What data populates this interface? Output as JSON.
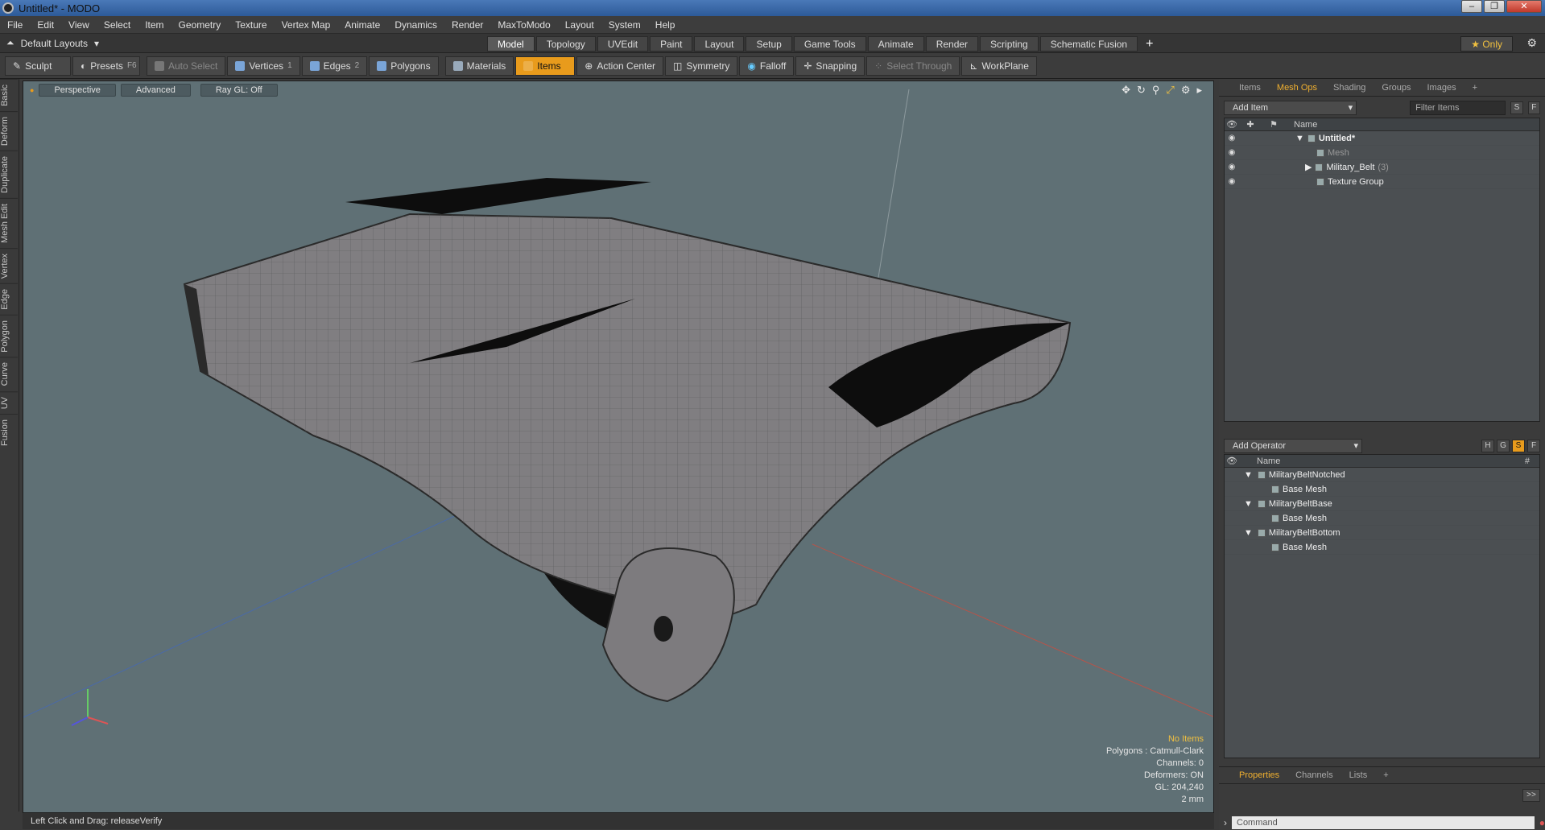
{
  "window": {
    "title": "Untitled* - MODO"
  },
  "menu": [
    "File",
    "Edit",
    "View",
    "Select",
    "Item",
    "Geometry",
    "Texture",
    "Vertex Map",
    "Animate",
    "Dynamics",
    "Render",
    "MaxToModo",
    "Layout",
    "System",
    "Help"
  ],
  "layout": {
    "dropdown": "Default Layouts",
    "tabs": [
      "Model",
      "Topology",
      "UVEdit",
      "Paint",
      "Layout",
      "Setup",
      "Game Tools",
      "Animate",
      "Render",
      "Scripting",
      "Schematic Fusion"
    ],
    "active_tab": "Model",
    "only_label": "Only"
  },
  "toolbar": {
    "sculpt": "Sculpt",
    "presets": "Presets",
    "presets_key": "F6",
    "auto_select": "Auto Select",
    "vertices": "Vertices",
    "vertices_key": "1",
    "edges": "Edges",
    "edges_key": "2",
    "polygons": "Polygons",
    "materials": "Materials",
    "items": "Items",
    "action_center": "Action Center",
    "symmetry": "Symmetry",
    "falloff": "Falloff",
    "snapping": "Snapping",
    "select_through": "Select Through",
    "workplane": "WorkPlane"
  },
  "left_tabs": [
    "Basic",
    "Deform",
    "Duplicate",
    "Mesh Edit",
    "Vertex",
    "Edge",
    "Polygon",
    "Curve",
    "UV",
    "Fusion"
  ],
  "viewport": {
    "view": "Perspective",
    "shading": "Advanced",
    "raygl": "Ray GL: Off",
    "info": [
      "No Items",
      "Polygons : Catmull-Clark",
      "Channels: 0",
      "Deformers: ON",
      "GL: 204,240",
      "2 mm"
    ]
  },
  "items_panel": {
    "tabs": [
      "Items",
      "Mesh Ops",
      "Shading",
      "Groups",
      "Images"
    ],
    "active": "Mesh Ops",
    "add_item": "Add Item",
    "filter_placeholder": "Filter Items",
    "s_btn": "S",
    "f_btn": "F",
    "header_name": "Name",
    "rows": [
      {
        "label": "Untitled*",
        "extra": ""
      },
      {
        "label": "Mesh",
        "extra": ""
      },
      {
        "label": "Military_Belt",
        "extra": "(3)"
      },
      {
        "label": "Texture Group",
        "extra": ""
      }
    ]
  },
  "operator_panel": {
    "add_operator": "Add Operator",
    "btns": [
      "H",
      "G",
      "S",
      "F"
    ],
    "header_name": "Name",
    "header_hash": "#",
    "rows": [
      {
        "label": "MilitaryBeltNotched"
      },
      {
        "label": "Base Mesh"
      },
      {
        "label": "MilitaryBeltBase"
      },
      {
        "label": "Base Mesh"
      },
      {
        "label": "MilitaryBeltBottom"
      },
      {
        "label": "Base Mesh"
      }
    ]
  },
  "bottom_tabs": [
    "Properties",
    "Channels",
    "Lists"
  ],
  "bottom_active": "Properties",
  "status": "Left Click and Drag:  releaseVerify",
  "command_placeholder": "Command",
  "arrow_btn": ">>"
}
